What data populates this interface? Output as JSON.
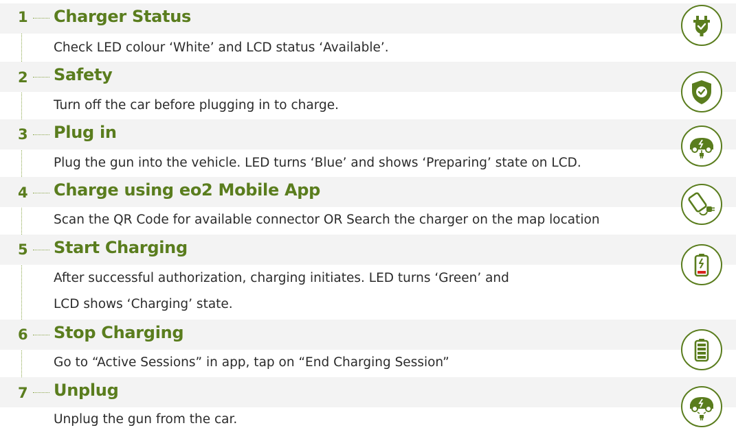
{
  "steps": [
    {
      "number": "1",
      "title": "Charger Status",
      "lines": [
        "Check LED colour ‘White’ and LCD status  ‘Available’."
      ],
      "icon": "plug-check-icon"
    },
    {
      "number": "2",
      "title": "Safety",
      "lines": [
        "Turn off the car before plugging in to charge."
      ],
      "icon": "shield-check-icon"
    },
    {
      "number": "3",
      "title": "Plug in",
      "lines": [
        "Plug the gun into the vehicle. LED turns ‘Blue’ and shows ‘Preparing’ state on LCD."
      ],
      "icon": "electric-car-plug-icon"
    },
    {
      "number": "4",
      "title": "Charge using eo2 Mobile App",
      "lines": [
        "Scan the QR Code for available connector OR Search the charger on the map location"
      ],
      "icon": "phone-plug-icon"
    },
    {
      "number": "5",
      "title": "Start Charging",
      "lines": [
        "After successful authorization, charging initiates. LED turns ‘Green’ and",
        "LCD shows ‘Charging’ state."
      ],
      "icon": "battery-charging-icon"
    },
    {
      "number": "6",
      "title": "Stop Charging",
      "lines": [
        "Go to “Active Sessions” in app, tap on “End Charging Session”"
      ],
      "icon": "battery-full-icon"
    },
    {
      "number": "7",
      "title": "Unplug",
      "lines": [
        "Unplug the gun from the car."
      ],
      "icon": "electric-car-unplug-icon"
    }
  ],
  "colors": {
    "accent": "#5a7d1e",
    "band": "#f3f3f3",
    "text": "#2b2b2b",
    "battery_low": "#d7261e"
  }
}
